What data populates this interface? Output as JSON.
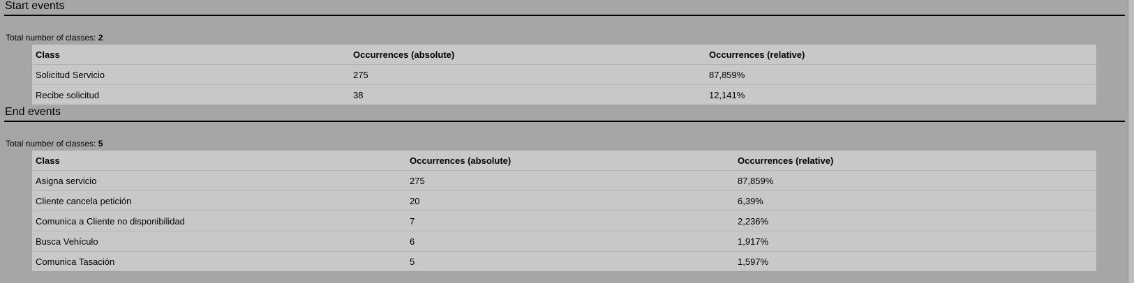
{
  "start_events": {
    "title": "Start events",
    "total_label": "Total number of classes:",
    "total_value": "2",
    "headers": [
      "Class",
      "Occurrences (absolute)",
      "Occurrences (relative)"
    ],
    "rows": [
      [
        "Solicitud Servicio",
        "275",
        "87,859%"
      ],
      [
        "Recibe solicitud",
        "38",
        "12,141%"
      ]
    ]
  },
  "end_events": {
    "title": "End events",
    "total_label": "Total number of classes:",
    "total_value": "5",
    "headers": [
      "Class",
      "Occurrences (absolute)",
      "Occurrences (relative)"
    ],
    "rows": [
      [
        "Asigna servicio",
        "275",
        "87,859%"
      ],
      [
        "Cliente cancela petición",
        "20",
        "6,39%"
      ],
      [
        "Comunica a Cliente no disponibilidad",
        "7",
        "2,236%"
      ],
      [
        "Busca Vehículo",
        "6",
        "1,917%"
      ],
      [
        "Comunica Tasación",
        "5",
        "1,597%"
      ]
    ]
  },
  "colors": {
    "page_background": "#a6a6a6",
    "table_background": "#c8c8cb",
    "rule": "#000000"
  }
}
